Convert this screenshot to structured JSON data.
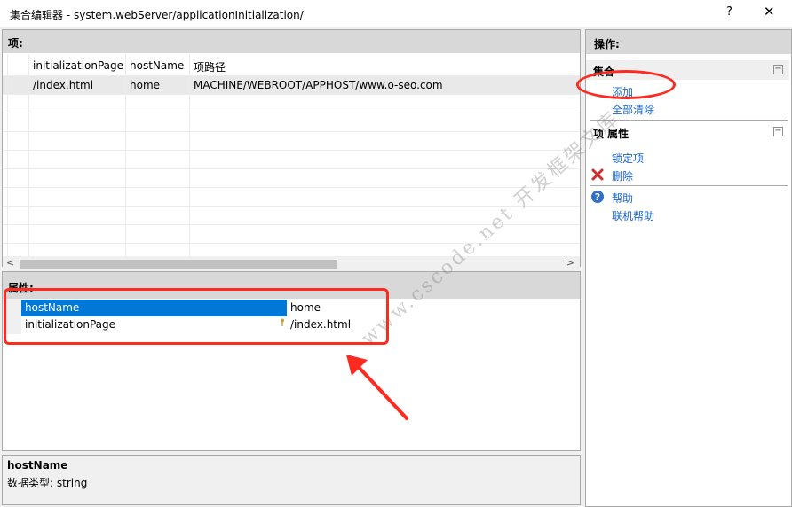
{
  "window": {
    "title": "集合编辑器 - system.webServer/applicationInitialization/",
    "help_label": "?",
    "close_label": "✕"
  },
  "items": {
    "header": "项:",
    "columns": [
      "initializationPage",
      "hostName",
      "项路径"
    ],
    "rows": [
      [
        "/index.html",
        "home",
        "MACHINE/WEBROOT/APPHOST/www.o-seo.com"
      ]
    ],
    "scroll_left": "<",
    "scroll_right": ">"
  },
  "properties": {
    "header": "属性:",
    "rows": [
      {
        "name": "hostName",
        "value": "home"
      },
      {
        "name": "initializationPage",
        "value": "/index.html"
      }
    ]
  },
  "description": {
    "name": "hostName",
    "type": "数据类型: string"
  },
  "actions": {
    "header": "操作:",
    "collection_section": "集合",
    "add": "添加",
    "clear_all": "全部清除",
    "item_props_section": "项 属性",
    "lock_item": "锁定项",
    "delete": "删除",
    "help": "帮助",
    "online_help": "联机帮助",
    "collapse_glyph": "−"
  },
  "watermark": "www.cscode.net 开发框架文库",
  "colors": {
    "selection": "#0078d7",
    "link": "#1a66c6",
    "annotation": "#ff2a1f"
  }
}
